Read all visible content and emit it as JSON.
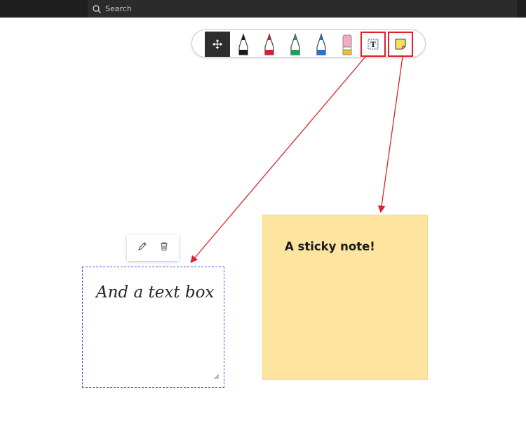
{
  "header": {
    "search_placeholder": "Search"
  },
  "toolbar": {
    "tools": [
      {
        "name": "move",
        "icon": "move-arrows-icon"
      },
      {
        "name": "black-pen",
        "icon": "pen-icon",
        "color": "#1a1a1a"
      },
      {
        "name": "red-pen",
        "icon": "pen-icon",
        "color": "#d0232f"
      },
      {
        "name": "green-pen",
        "icon": "pen-icon",
        "color": "#1e9e5a"
      },
      {
        "name": "blue-pen",
        "icon": "pen-icon",
        "color": "#2a6fd6"
      },
      {
        "name": "eraser",
        "icon": "eraser-icon"
      },
      {
        "name": "text-box",
        "icon": "text-box-icon",
        "glyph": "T"
      },
      {
        "name": "sticky-note",
        "icon": "sticky-note-icon",
        "color": "#f7e05a"
      }
    ]
  },
  "annotation": {
    "arrow_color": "#e0202a",
    "highlight_color": "#e0202a"
  },
  "text_box": {
    "text": "And a text box",
    "border_color": "#4a5fe0"
  },
  "sticky_note": {
    "text": "A sticky note!",
    "color": "#fde59f"
  }
}
